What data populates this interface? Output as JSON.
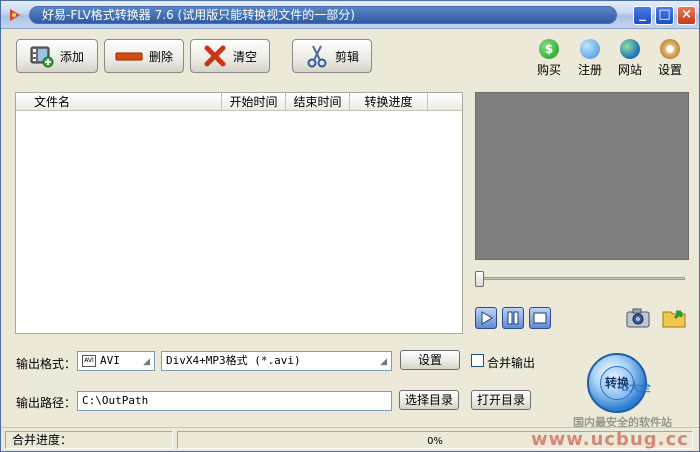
{
  "window": {
    "title": "好易-FLV格式转换器 7.6 (试用版只能转换视文件的一部分)",
    "controls": {
      "minimize": "_",
      "maximize": "□",
      "close": "×"
    }
  },
  "toolbar": {
    "add_label": "添加",
    "delete_label": "删除",
    "clear_label": "清空",
    "cut_label": "剪辑"
  },
  "quick_links": [
    {
      "label": "购买",
      "icon": "dollar-coin-icon"
    },
    {
      "label": "注册",
      "icon": "register-icon"
    },
    {
      "label": "网站",
      "icon": "globe-icon"
    },
    {
      "label": "设置",
      "icon": "settings-icon"
    }
  ],
  "file_list": {
    "columns": [
      "文件名",
      "开始时间",
      "结束时间",
      "转换进度"
    ],
    "rows": []
  },
  "player": {
    "play_icon": "play-icon",
    "pause_icon": "pause-icon",
    "stop_icon": "stop-icon",
    "snapshot_icon": "camera-icon",
    "open_folder_icon": "folder-open-icon",
    "seek_position": 0
  },
  "output": {
    "format_label": "输出格式：",
    "format_type": "AVI",
    "format_badge": "AVI",
    "format_desc": "DivX4+MP3格式 (*.avi)",
    "settings_button": "设置",
    "merge_label": "合并输出",
    "merge_checked": false,
    "path_label": "输出路径：",
    "path_value": "C:\\OutPath",
    "choose_dir_button": "选择目录",
    "open_dir_button": "打开目录"
  },
  "convert_button": "转换",
  "status": {
    "merge_progress_label": "合并进度：",
    "progress_text": "0%",
    "progress": 0
  },
  "watermark": {
    "site": "www.ucbug.cc",
    "slogan": "国内最安全的软件站",
    "brand": "u大全"
  },
  "colors": {
    "title_bar": "#2e5aa3",
    "window_bg": "#ece9d8",
    "preview_bg": "#7f7f7f",
    "accent_blue": "#2f7fd3",
    "watermark_red": "#c0392b"
  }
}
